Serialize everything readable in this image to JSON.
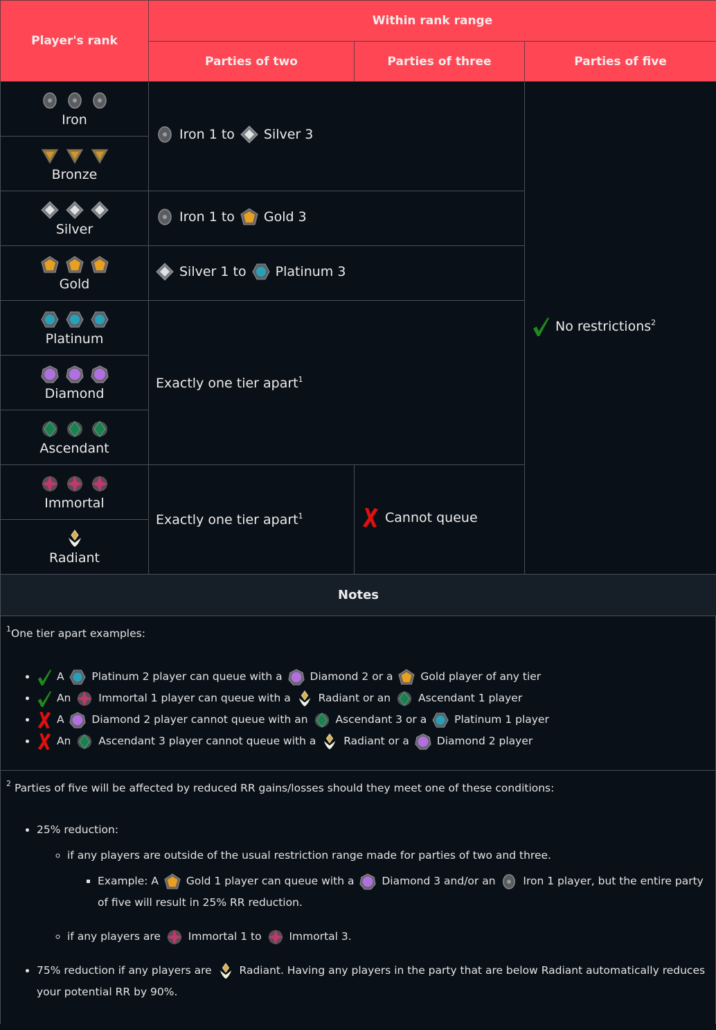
{
  "header": {
    "players_rank": "Player's rank",
    "within_rank_range": "Within rank range",
    "parties_of_two": "Parties of two",
    "parties_of_three": "Parties of three",
    "parties_of_five": "Parties of five"
  },
  "colors": {
    "header_bg": "#ff4655",
    "body_bg": "#0a1017",
    "check": "#1e8a1e",
    "cross": "#e01010"
  },
  "ranks": [
    {
      "name": "Iron",
      "icon": "iron-rank-icon"
    },
    {
      "name": "Bronze",
      "icon": "bronze-rank-icon"
    },
    {
      "name": "Silver",
      "icon": "silver-rank-icon"
    },
    {
      "name": "Gold",
      "icon": "gold-rank-icon"
    },
    {
      "name": "Platinum",
      "icon": "platinum-rank-icon"
    },
    {
      "name": "Diamond",
      "icon": "diamond-rank-icon"
    },
    {
      "name": "Ascendant",
      "icon": "ascendant-rank-icon"
    },
    {
      "name": "Immortal",
      "icon": "immortal-rank-icon"
    },
    {
      "name": "Radiant",
      "icon": "radiant-rank-icon"
    }
  ],
  "ranges": {
    "iron_bronze": {
      "from": "Iron 1 to",
      "to": "Silver 3"
    },
    "silver": {
      "from": "Iron 1 to",
      "to": "Gold 3"
    },
    "gold": {
      "from": "Silver 1 to",
      "to": "Platinum 3"
    },
    "plat_asc": "Exactly one tier apart",
    "imm_rad_two": "Exactly one tier apart",
    "imm_rad_three": "Cannot queue",
    "five": "No restrictions",
    "sup1": "1",
    "sup2": "2"
  },
  "notes": {
    "title": "Notes",
    "note1": {
      "marker": "1",
      "title": "One tier apart examples:",
      "examples": [
        {
          "status": "check",
          "parts": [
            "A",
            "Platinum 2 player can queue with a",
            "Diamond 2 or a",
            "Gold player of any tier"
          ]
        },
        {
          "status": "check",
          "parts": [
            "An",
            "Immortal 1 player can queue with a",
            "Radiant or an",
            "Ascendant 1 player"
          ]
        },
        {
          "status": "cross",
          "parts": [
            "A",
            "Diamond 2 player cannot queue with an",
            "Ascendant 3 or a",
            "Platinum 1 player"
          ]
        },
        {
          "status": "cross",
          "parts": [
            "An",
            "Ascendant 3 player cannot queue with a",
            "Radiant or a",
            "Diamond 2 player"
          ]
        }
      ]
    },
    "note2": {
      "marker": "2",
      "title": "Parties of five will be affected by reduced RR gains/losses should they meet one of these conditions:",
      "reduction25": "25% reduction:",
      "outside_range": "if any players are outside of the usual restriction range made for parties of two and three.",
      "example": [
        "Example: A",
        "Gold 1 player can queue with a",
        "Diamond 3 and/or an",
        "Iron 1 player, but the entire party of five will result in 25% RR reduction."
      ],
      "immortal": [
        "if any players are",
        "Immortal 1 to",
        "Immortal 3."
      ],
      "reduction75": [
        "75% reduction if any players are",
        "Radiant. Having any players in the party that are below Radiant automatically reduces your potential RR by 90%."
      ]
    }
  }
}
